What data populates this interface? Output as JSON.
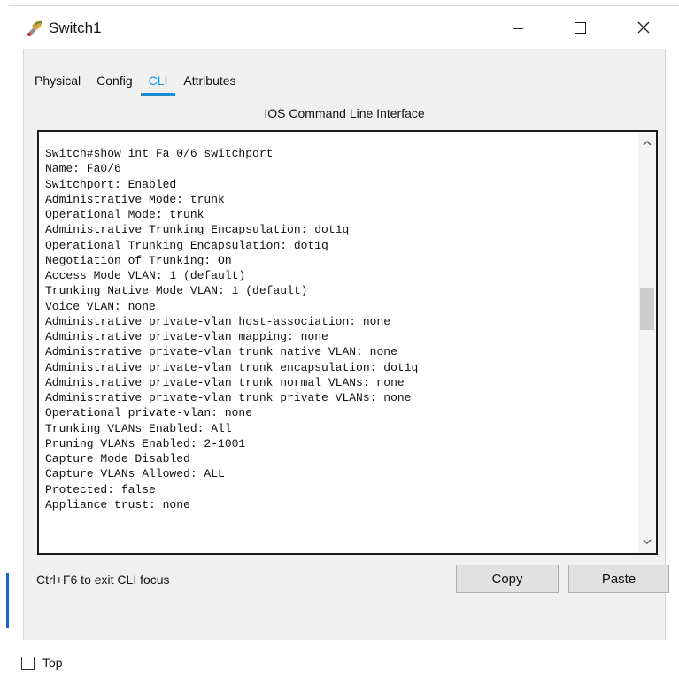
{
  "window": {
    "title": "Switch1",
    "controls": {
      "minimize": "—",
      "maximize": "☐",
      "close": "✕"
    }
  },
  "tabs": [
    {
      "label": "Physical",
      "active": false
    },
    {
      "label": "Config",
      "active": false
    },
    {
      "label": "CLI",
      "active": true
    },
    {
      "label": "Attributes",
      "active": false
    }
  ],
  "cli": {
    "panel_title": "IOS Command Line Interface",
    "lines": [
      "Switch#show int Fa 0/6 switchport",
      "Name: Fa0/6",
      "Switchport: Enabled",
      "Administrative Mode: trunk",
      "Operational Mode: trunk",
      "Administrative Trunking Encapsulation: dot1q",
      "Operational Trunking Encapsulation: dot1q",
      "Negotiation of Trunking: On",
      "Access Mode VLAN: 1 (default)",
      "Trunking Native Mode VLAN: 1 (default)",
      "Voice VLAN: none",
      "Administrative private-vlan host-association: none",
      "Administrative private-vlan mapping: none",
      "Administrative private-vlan trunk native VLAN: none",
      "Administrative private-vlan trunk encapsulation: dot1q",
      "Administrative private-vlan trunk normal VLANs: none",
      "Administrative private-vlan trunk private VLANs: none",
      "Operational private-vlan: none",
      "Trunking VLANs Enabled: All",
      "Pruning VLANs Enabled: 2-1001",
      "Capture Mode Disabled",
      "Capture VLANs Allowed: ALL",
      "Protected: false",
      "Appliance trust: none"
    ],
    "hint": "Ctrl+F6 to exit CLI focus",
    "copy_label": "Copy",
    "paste_label": "Paste"
  },
  "footer": {
    "top_label": "Top",
    "top_checked": false
  },
  "colors": {
    "accent": "#1f8bd8",
    "client_bg": "#f0f0f0"
  }
}
